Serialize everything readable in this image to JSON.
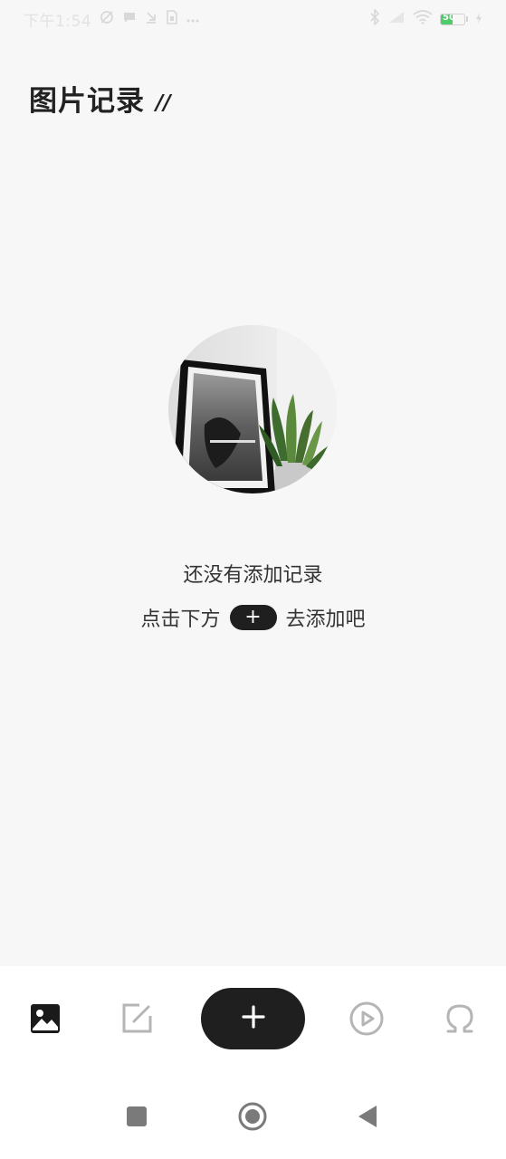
{
  "status_bar": {
    "time": "下午1:54",
    "left_icons": [
      "sync-icon",
      "chat-icon",
      "download-icon",
      "sim-icon",
      "more-dots-icon"
    ],
    "right_icons": [
      "bluetooth-icon",
      "signal-icon",
      "wifi-icon",
      "battery-icon",
      "charging-icon"
    ],
    "battery_level": "50"
  },
  "header": {
    "title": "图片记录",
    "title_mark": "//"
  },
  "empty_state": {
    "title": "还没有添加记录",
    "hint_before": "点击下方",
    "hint_button": "+",
    "hint_after": "去添加吧"
  },
  "bottom_nav": {
    "items": [
      {
        "icon": "image-icon",
        "active": true
      },
      {
        "icon": "edit-icon",
        "active": false
      },
      {
        "icon": "add-icon",
        "active": false
      },
      {
        "icon": "play-circle-icon",
        "active": false
      },
      {
        "icon": "omega-icon",
        "active": false
      }
    ],
    "add_label": "+"
  },
  "colors": {
    "background": "#f7f7f7",
    "nav_background": "#ffffff",
    "accent_dark": "#1f1f1f",
    "inactive_icon": "#b5b5b5",
    "battery_green": "#4fcc6a"
  }
}
